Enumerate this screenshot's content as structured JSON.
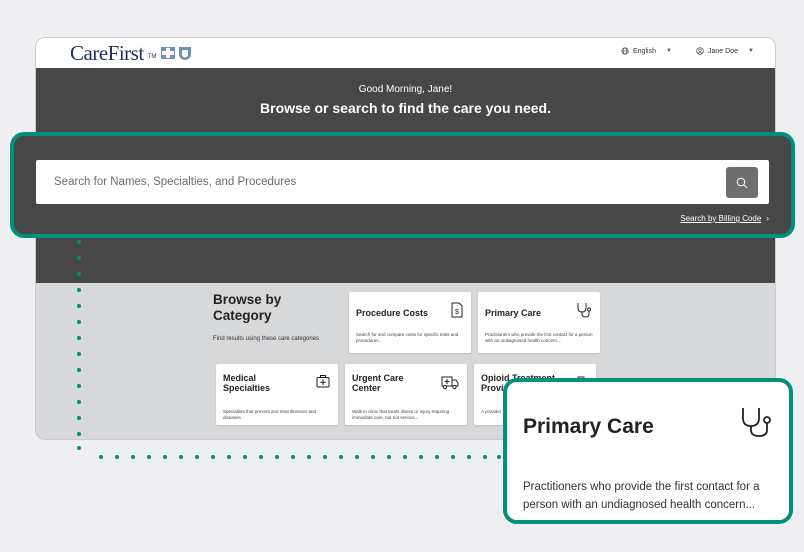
{
  "header": {
    "logo_text": "CareFirst",
    "logo_tm": "TM",
    "language": "English",
    "user": "Jane Doe"
  },
  "hero": {
    "greeting": "Good Morning, Jane!",
    "headline": "Browse or search to find the care you need."
  },
  "search": {
    "placeholder": "Search for Names, Specialties, and Procedures",
    "billing_link": "Search by Billing Code"
  },
  "browse": {
    "title_line1": "Browse by",
    "title_line2": "Category",
    "subtitle": "Find results using these care categories"
  },
  "cards": [
    {
      "title": "Procedure Costs",
      "desc": "Search for and compare costs for specific tests and procedures.",
      "icon": "price-tag-icon"
    },
    {
      "title": "Primary Care",
      "desc": "Practitioners who provide the first contact for a person with an undiagnosed health concern...",
      "icon": "stethoscope-icon"
    },
    {
      "title": "Medical Specialties",
      "desc": "Specialties that prevent and treat illnesses and diseases",
      "icon": "medical-bag-icon"
    },
    {
      "title": "Urgent Care Center",
      "desc": "Walk-in clinic that treats illness or injury requiring immediate care, but not serious...",
      "icon": "ambulance-icon"
    },
    {
      "title": "Opioid Treatment Provi",
      "desc": "A provider",
      "icon": "treatment-icon"
    }
  ],
  "zoom": {
    "title": "Primary Care",
    "desc_line1": "Practitioners who provide the first contact for a",
    "desc_line2": "person with an undiagnosed health concern..."
  },
  "colors": {
    "accent": "#00917a",
    "hero_bg": "#474747",
    "page_bg": "#efeff1"
  }
}
